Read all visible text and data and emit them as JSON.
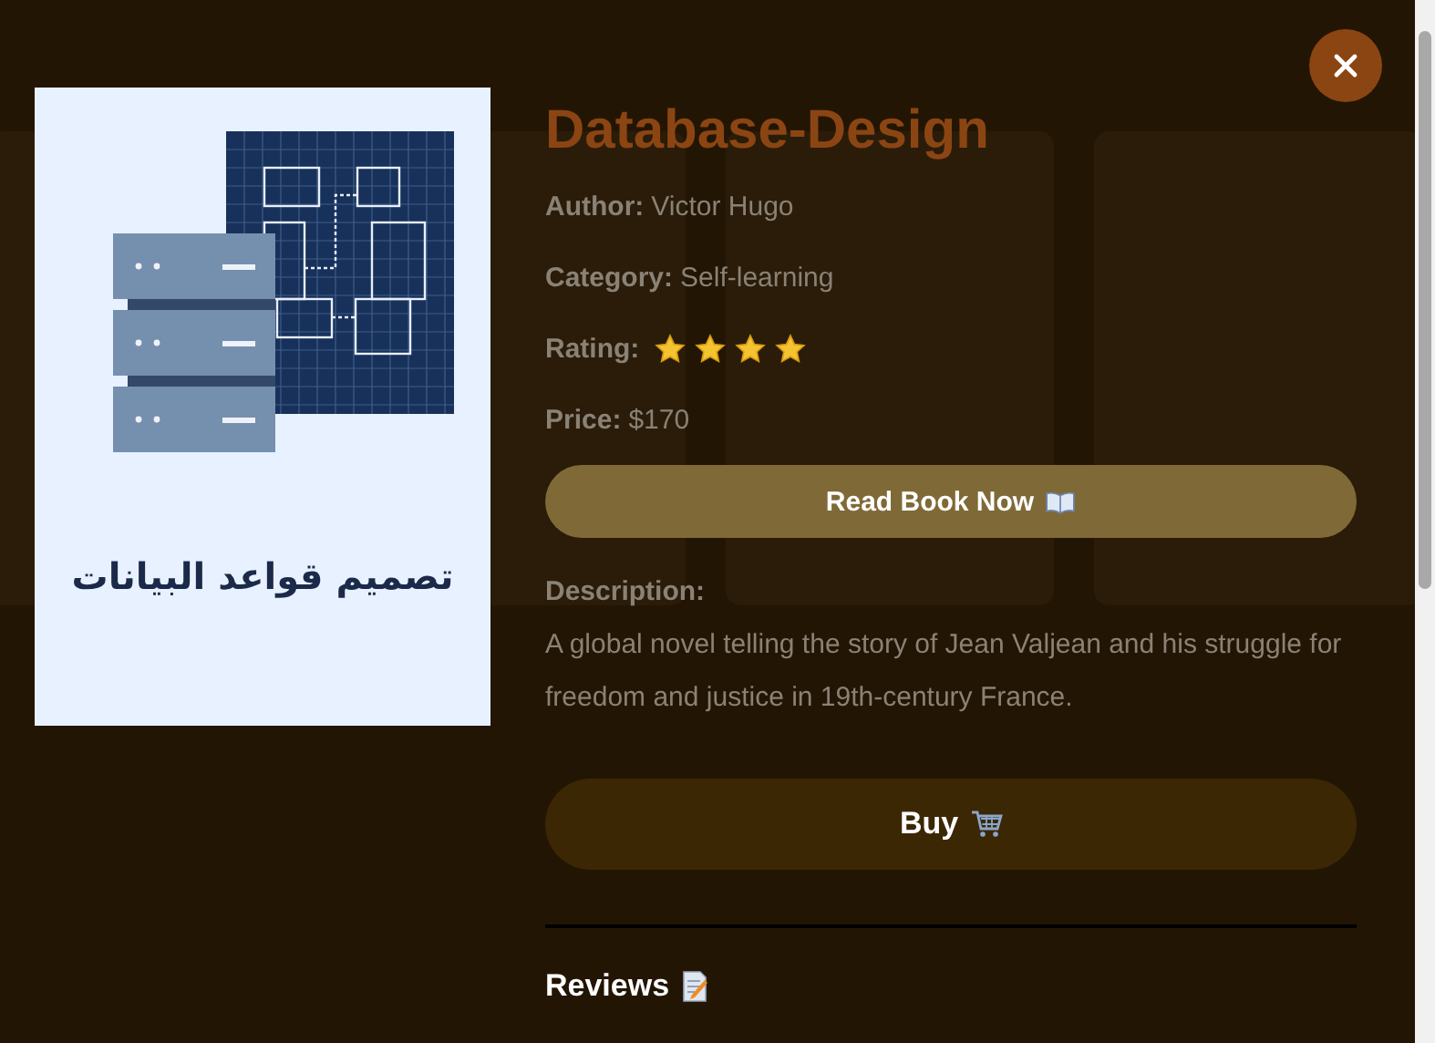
{
  "modal": {
    "cover_title": "تصميم قواعد البيانات",
    "title": "Database-Design",
    "fields": [
      {
        "label": "Author:",
        "value": "Victor Hugo"
      },
      {
        "label": "Category:",
        "value": "Self-learning"
      }
    ],
    "rating_label": "Rating:",
    "stars": 4,
    "price_label": "Price:",
    "price": "$170",
    "read_button": "Read Book Now",
    "description_label": "Description:",
    "description": "A global novel telling the story of Jean Valjean and his struggle for freedom and justice in 19th-century France.",
    "buy_button": "Buy",
    "reviews_heading": "Reviews"
  }
}
